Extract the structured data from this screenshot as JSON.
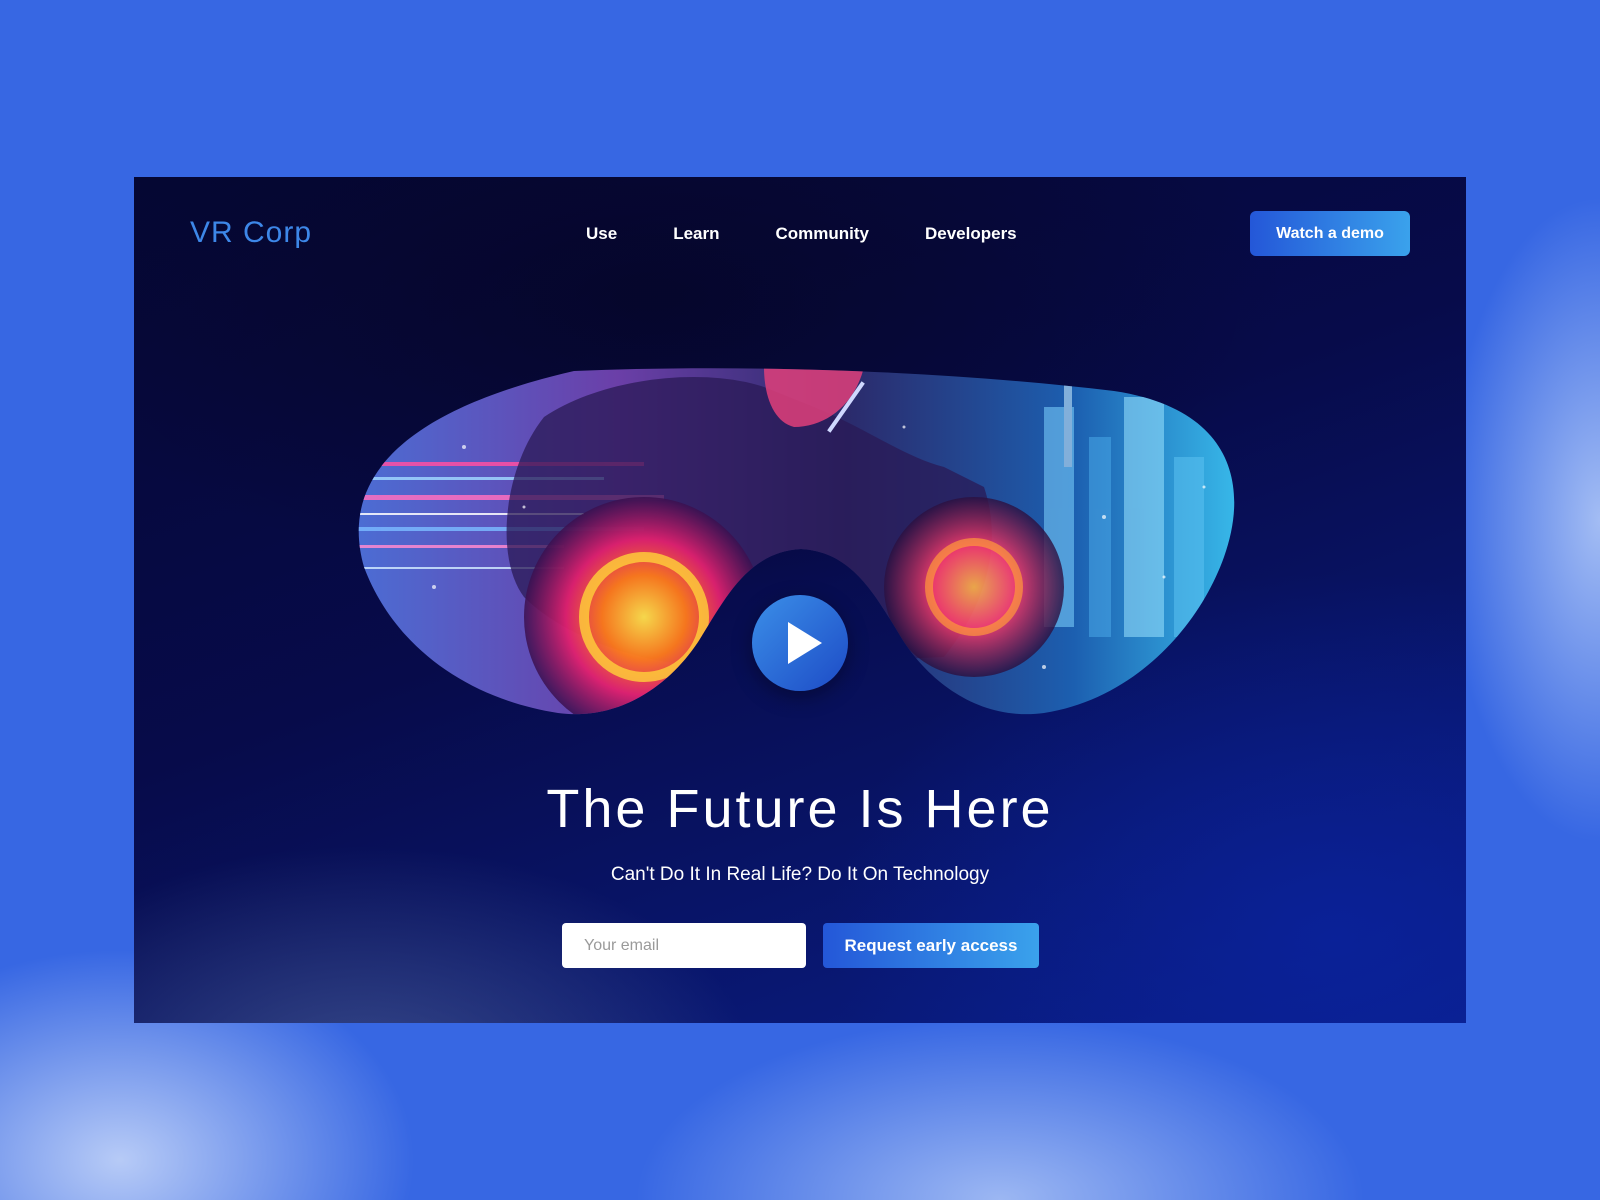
{
  "brand": {
    "name": "VR Corp"
  },
  "nav": {
    "items": [
      {
        "label": "Use"
      },
      {
        "label": "Learn"
      },
      {
        "label": "Community"
      },
      {
        "label": "Developers"
      }
    ],
    "cta_label": "Watch a demo"
  },
  "hero": {
    "image": "vr-goggles-cyberpunk-motorcycle",
    "play_icon": "play-icon",
    "title": "The Future Is Here",
    "subtitle": "Can't Do It In Real Life? Do It On Technology",
    "email_placeholder": "Your email",
    "email_value": "",
    "submit_label": "Request early access"
  },
  "colors": {
    "page_background": "#3767e3",
    "frame_background": "#070b4a",
    "accent": "#3aa2ec",
    "logo": "#3d87e8"
  }
}
